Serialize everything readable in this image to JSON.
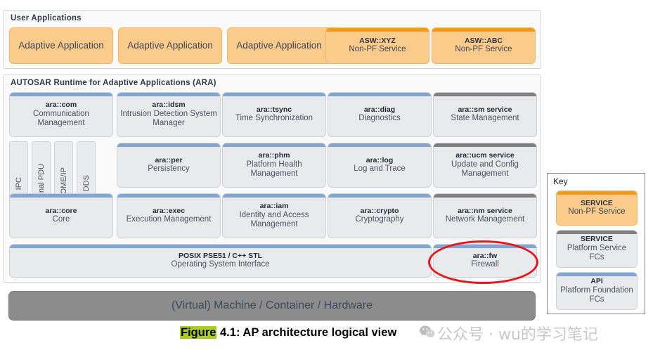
{
  "user_applications": {
    "title": "User Applications",
    "apps": [
      {
        "label": "Adaptive Application"
      },
      {
        "label": "Adaptive Application"
      },
      {
        "label": "Adaptive Application"
      }
    ],
    "services": [
      {
        "name": "ASW::XYZ",
        "desc": "Non-PF Service"
      },
      {
        "name": "ASW::ABC",
        "desc": "Non-PF Service"
      }
    ]
  },
  "ara": {
    "title": "AUTOSAR Runtime for Adaptive Applications  (ARA)",
    "protocols": [
      {
        "label": "IPC"
      },
      {
        "label": "Signal PDU"
      },
      {
        "label": "SOME/IP"
      },
      {
        "label": "DDS"
      }
    ],
    "row1": [
      {
        "name": "ara::com",
        "desc": "Communication Management",
        "kind": "api"
      },
      {
        "name": "ara::idsm",
        "desc": "Intrusion Detection System Manager",
        "kind": "api"
      },
      {
        "name": "ara::tsync",
        "desc": "Time Synchronization",
        "kind": "api"
      },
      {
        "name": "ara::diag",
        "desc": "Diagnostics",
        "kind": "api"
      },
      {
        "name": "ara::sm service",
        "desc": "State Management",
        "kind": "svc"
      }
    ],
    "row2": [
      {
        "name": "ara::per",
        "desc": "Persistency",
        "kind": "api"
      },
      {
        "name": "ara::phm",
        "desc": "Platform Health Management",
        "kind": "api"
      },
      {
        "name": "ara::log",
        "desc": "Log and Trace",
        "kind": "api"
      },
      {
        "name": "ara::ucm service",
        "desc": "Update and Config Management",
        "kind": "svc"
      }
    ],
    "row3": [
      {
        "name": "ara::core",
        "desc": "Core",
        "kind": "api"
      },
      {
        "name": "ara::exec",
        "desc": "Execution Management",
        "kind": "api"
      },
      {
        "name": "ara::iam",
        "desc": "Identity and Access Management",
        "kind": "api"
      },
      {
        "name": "ara::crypto",
        "desc": "Cryptography",
        "kind": "api"
      },
      {
        "name": "ara::nm service",
        "desc": "Network Management",
        "kind": "svc"
      }
    ],
    "os": {
      "name": "POSIX PSE51 / C++ STL",
      "desc": "Operating System Interface",
      "kind": "api"
    },
    "firewall": {
      "name": "ara::fw",
      "desc": "Firewall",
      "kind": "api",
      "highlighted": true
    }
  },
  "hardware": {
    "label": "(Virtual) Machine / Container / Hardware"
  },
  "key": {
    "title": "Key",
    "items": [
      {
        "name": "SERVICE",
        "desc": "Non-PF Service",
        "kind": "asw"
      },
      {
        "name": "SERVICE",
        "desc": "Platform Service FCs",
        "kind": "svc"
      },
      {
        "name": "API",
        "desc": "Platform Foundation FCs",
        "kind": "api"
      }
    ]
  },
  "caption": {
    "highlight": "Figure",
    "rest": " 4.1: AP architecture logical view"
  },
  "watermark": {
    "icon": "wechat-icon",
    "text": "公众号 · wu的学习笔记"
  },
  "colors": {
    "orange_fill": "#FBCB8C",
    "orange_bar": "#F59B1C",
    "api_bar": "#82A6D4",
    "service_bar": "#808080",
    "box_body": "#E8EAEC",
    "hardware": "#8C8C8C",
    "highlight_ring": "#E8151B",
    "caption_highlight": "#A9CF1C"
  }
}
